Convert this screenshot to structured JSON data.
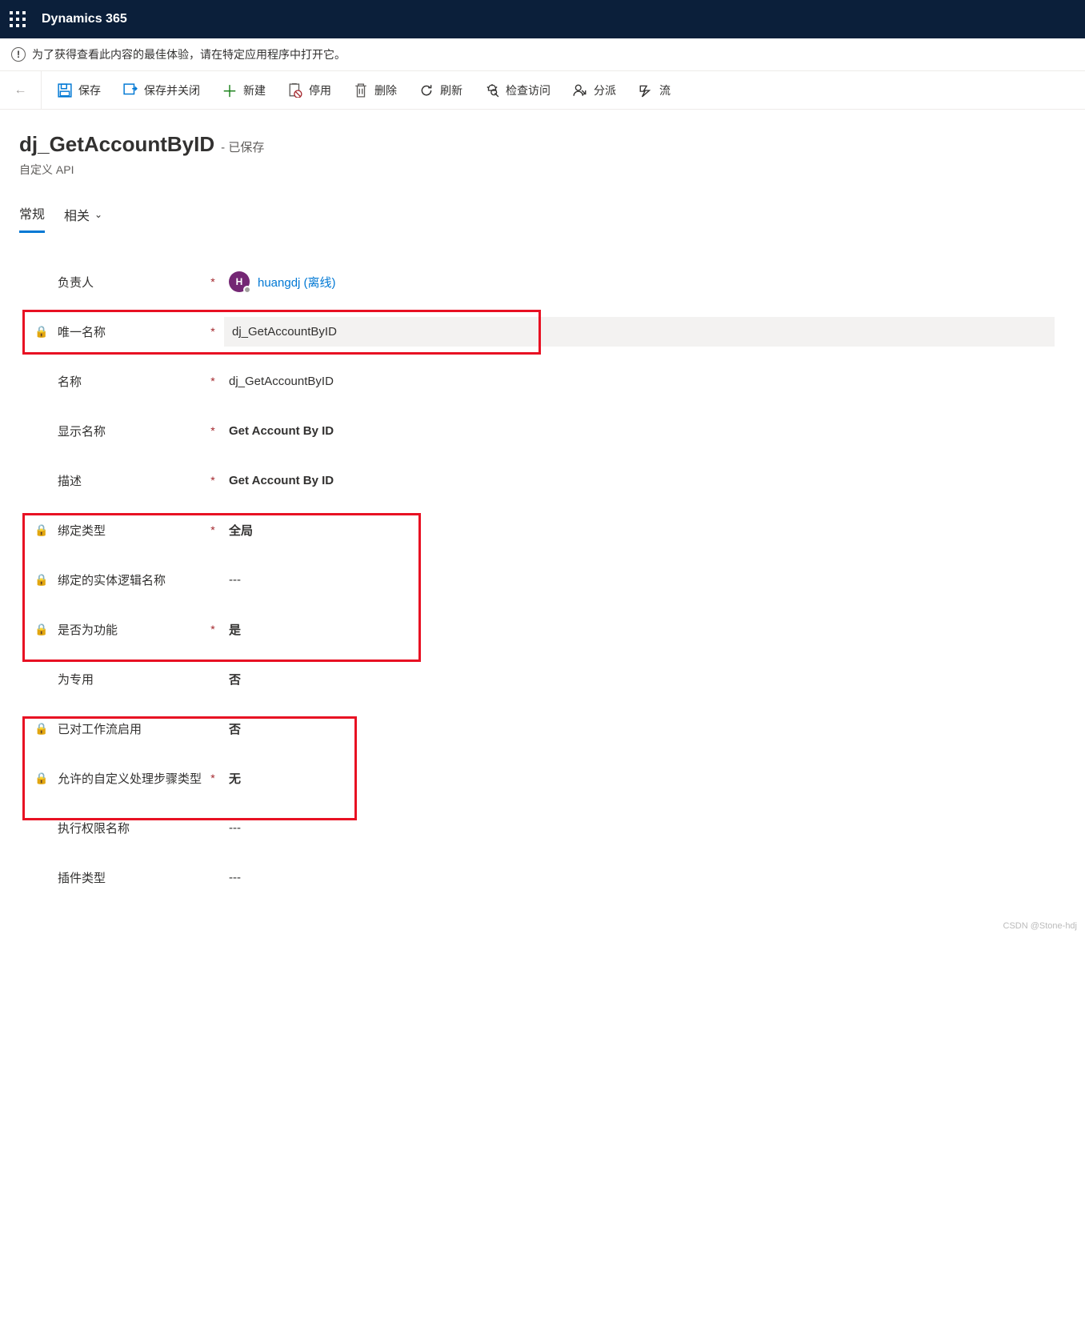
{
  "topbar": {
    "app_name": "Dynamics 365"
  },
  "notice": {
    "text": "为了获得查看此内容的最佳体验，请在特定应用程序中打开它。"
  },
  "toolbar": {
    "save": "保存",
    "save_close": "保存并关闭",
    "new": "新建",
    "deactivate": "停用",
    "delete": "删除",
    "refresh": "刷新",
    "check_access": "检查访问",
    "assign": "分派",
    "flow": "流"
  },
  "header": {
    "title": "dj_GetAccountByID",
    "suffix": "- 已保存",
    "subtitle": "自定义 API"
  },
  "tabs": {
    "general": "常规",
    "related": "相关"
  },
  "form": {
    "owner": {
      "label": "负责人",
      "value": "huangdj (离线)",
      "avatar_initial": "H"
    },
    "unique_name": {
      "label": "唯一名称",
      "value": "dj_GetAccountByID"
    },
    "name": {
      "label": "名称",
      "value": "dj_GetAccountByID"
    },
    "display_name": {
      "label": "显示名称",
      "value": "Get Account By ID"
    },
    "description": {
      "label": "描述",
      "value": "Get Account By ID"
    },
    "binding_type": {
      "label": "绑定类型",
      "value": "全局"
    },
    "bound_entity": {
      "label": "绑定的实体逻辑名称",
      "value": "---"
    },
    "is_function": {
      "label": "是否为功能",
      "value": "是"
    },
    "is_private": {
      "label": "为专用",
      "value": "否"
    },
    "workflow_enabled": {
      "label": "已对工作流启用",
      "value": "否"
    },
    "allowed_steps": {
      "label": "允许的自定义处理步骤类型",
      "value": "无"
    },
    "execute_privilege": {
      "label": "执行权限名称",
      "value": "---"
    },
    "plugin_type": {
      "label": "插件类型",
      "value": "---"
    }
  },
  "watermark": "CSDN @Stone-hdj"
}
